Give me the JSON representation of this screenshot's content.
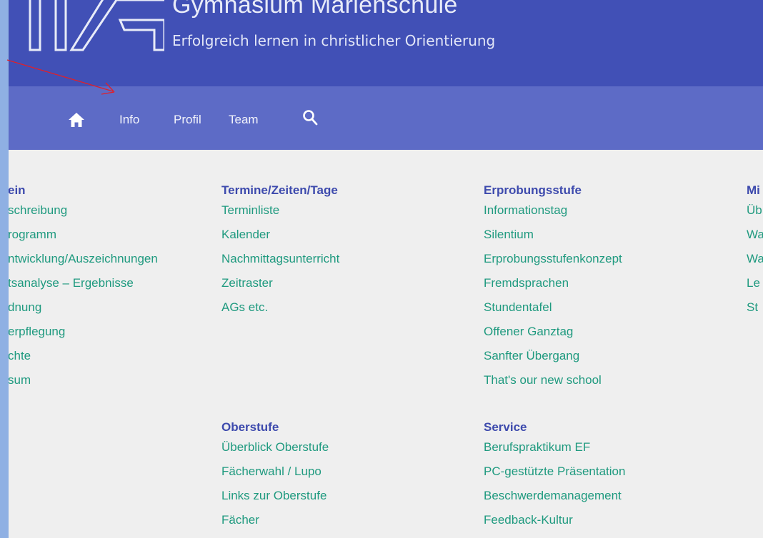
{
  "header": {
    "site_name": "Gymnasium Marienschule",
    "tagline": "Erfolgreich lernen in christlicher Orientierung"
  },
  "nav": {
    "items": [
      {
        "label": "Info"
      },
      {
        "label": "Profil"
      },
      {
        "label": "Team"
      }
    ]
  },
  "menu": {
    "col1": {
      "heading": "ein",
      "links": [
        "schreibung",
        "rogramm",
        "ntwicklung/Auszeichnungen",
        "tsanalyse – Ergebnisse",
        "dnung",
        "erpflegung",
        "chte",
        "sum"
      ]
    },
    "col2": {
      "heading": "Termine/Zeiten/Tage",
      "links": [
        "Terminliste",
        "Kalender",
        "Nachmittagsunterricht",
        "Zeitraster",
        "AGs etc."
      ]
    },
    "col2b": {
      "heading": "Oberstufe",
      "links": [
        "Überblick Oberstufe",
        "Fächerwahl / Lupo",
        "Links zur Oberstufe",
        "Fächer"
      ]
    },
    "col3": {
      "heading": "Erprobungsstufe",
      "links": [
        "Informationstag",
        "Silentium",
        "Erprobungsstufenkonzept",
        "Fremdsprachen",
        "Stundentafel",
        "Offener Ganztag",
        "Sanfter Übergang",
        "That's our new school"
      ]
    },
    "col3b": {
      "heading": "Service",
      "links": [
        "Berufspraktikum EF",
        "PC-gestützte Präsentation",
        "Beschwerdemanagement",
        "Feedback-Kultur"
      ]
    },
    "col4": {
      "heading": "Mi",
      "links": [
        "Üb",
        "Wa",
        "Wa",
        "Le",
        "St"
      ]
    }
  },
  "colors": {
    "header_bg": "#4150b6",
    "nav_bg": "#5d6bc6",
    "heading": "#3d4aad",
    "link": "#1f9a7f",
    "annotation_arrow": "#e0202a"
  },
  "icons": [
    "logo-mark",
    "home-icon",
    "search-icon",
    "annotation-arrow"
  ]
}
